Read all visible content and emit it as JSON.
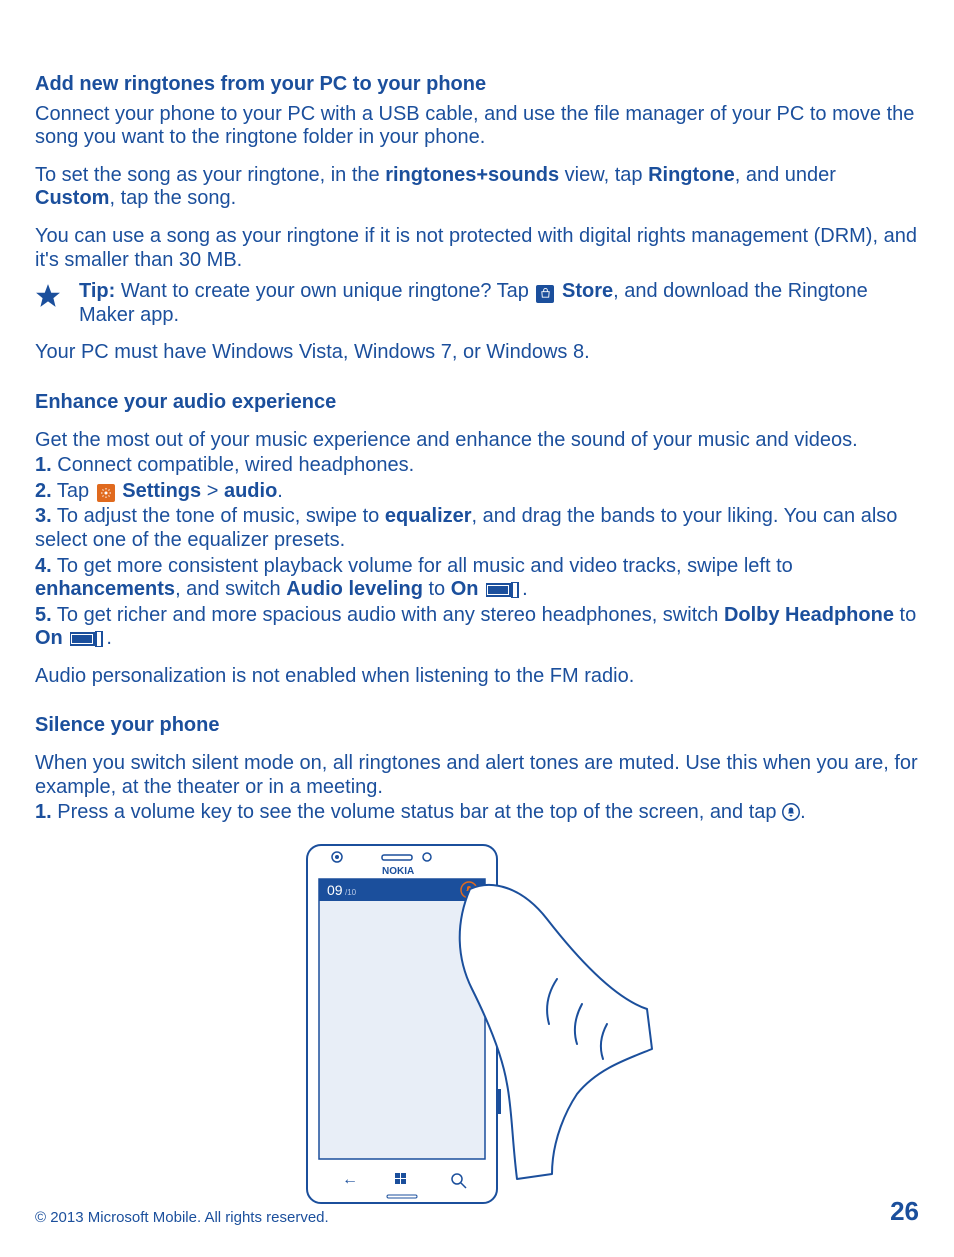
{
  "sec1": {
    "title": "Add new ringtones from your PC to your phone",
    "p1": "Connect your phone to your PC with a USB cable, and use the file manager of your PC to move the song you want to the ringtone folder in your phone.",
    "p2_a": "To set the song as your ringtone, in the ",
    "p2_b": "ringtones+sounds",
    "p2_c": " view, tap ",
    "p2_d": "Ringtone",
    "p2_e": ", and under ",
    "p2_f": "Custom",
    "p2_g": ", tap the song.",
    "p3": "You can use a song as your ringtone if it is not protected with digital rights management (DRM), and it's smaller than 30 MB.",
    "tip_label": "Tip: ",
    "tip_a": "Want to create your own unique ringtone? Tap ",
    "tip_store": "Store",
    "tip_b": ", and download the Ringtone Maker app.",
    "p4": "Your PC must have Windows Vista, Windows 7, or Windows 8."
  },
  "sec2": {
    "title": "Enhance your audio experience",
    "p1": "Get the most out of your music experience and enhance the sound of your music and videos.",
    "step1": " Connect compatible, wired headphones.",
    "step2_a": " Tap ",
    "step2_settings": "Settings",
    "step2_gt": " > ",
    "step2_audio": "audio",
    "step3_a": " To adjust the tone of music, swipe to ",
    "step3_eq": "equalizer",
    "step3_b": ", and drag the bands to your liking. You can also select one of the equalizer presets.",
    "step4_a": " To get more consistent playback volume for all music and video tracks, swipe left to ",
    "step4_enh": "enhancements",
    "step4_b": ", and switch ",
    "step4_al": "Audio leveling",
    "step4_c": " to ",
    "step4_on": "On",
    "step5_a": " To get richer and more spacious audio with any stereo headphones, switch ",
    "step5_dh": "Dolby Headphone",
    "step5_b": " to ",
    "step5_on": "On",
    "p2": "Audio personalization is not enabled when listening to the FM radio."
  },
  "sec3": {
    "title": "Silence your phone",
    "p1": "When you switch silent mode on, all ringtones and alert tones are muted. Use this when you are, for example, at the theater or in a meeting.",
    "step1_a": " Press a volume key to see the volume status bar at the top of the screen, and tap "
  },
  "nums": {
    "n1": "1.",
    "n2": "2.",
    "n3": "3.",
    "n4": "4.",
    "n5": "5."
  },
  "footer": {
    "copyright": "© 2013 Microsoft Mobile. All rights reserved.",
    "page": "26"
  }
}
